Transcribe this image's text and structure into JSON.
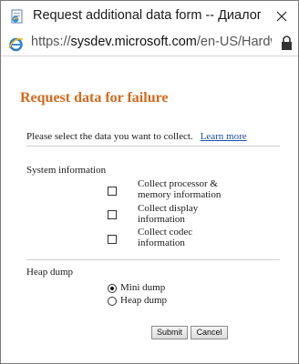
{
  "window": {
    "title": "Request additional data form -- Диалогово...",
    "url_prefix": "https://",
    "url_host": "sysdev.microsoft.com",
    "url_path": "/en-US/Hardware/"
  },
  "form": {
    "heading": "Request data for failure",
    "instructions": "Please select the data you want to collect.",
    "learn_more": "Learn more",
    "system_info": {
      "label": "System information",
      "options": [
        {
          "line1": "Collect processor &",
          "line2": "memory information",
          "checked": false
        },
        {
          "line1": "Collect display",
          "line2": "information",
          "checked": false
        },
        {
          "line1": "Collect codec",
          "line2": "information",
          "checked": false
        }
      ]
    },
    "heap_dump": {
      "label": "Heap dump",
      "options": [
        {
          "label": "Mini dump",
          "checked": true
        },
        {
          "label": "Heap dump",
          "checked": false
        }
      ]
    },
    "submit_label": "Submit",
    "cancel_label": "Cancel"
  },
  "colors": {
    "heading": "#d4691c",
    "link": "#1a4fa8"
  }
}
